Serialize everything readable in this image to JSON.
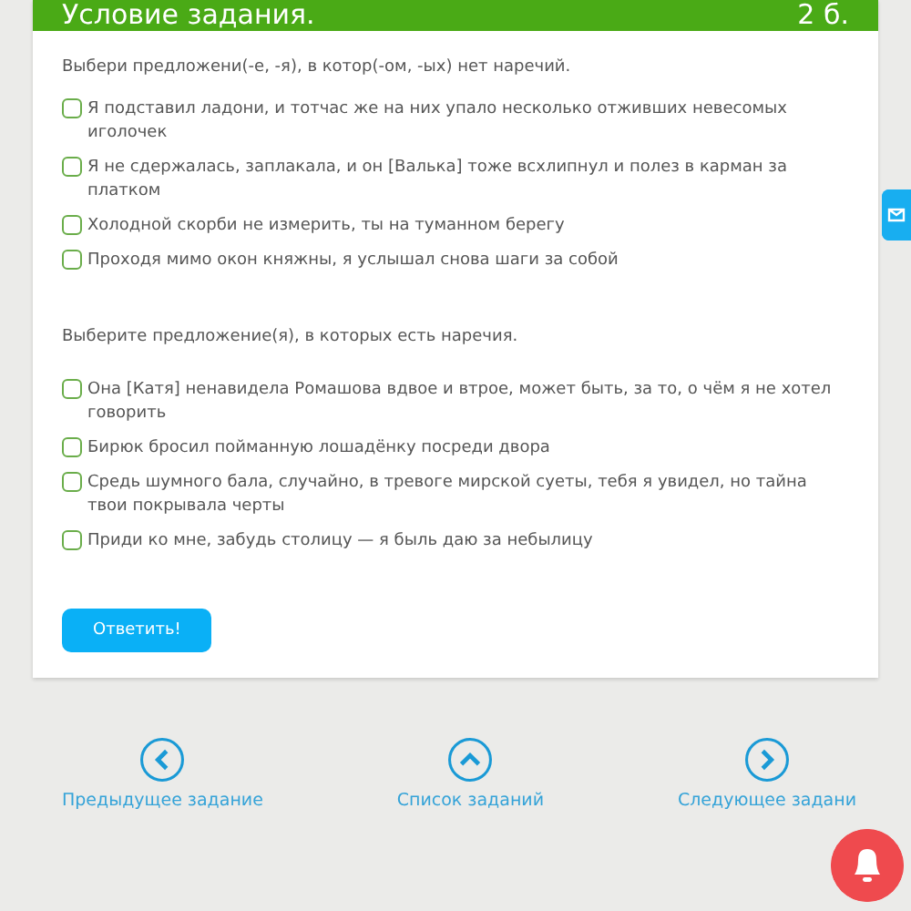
{
  "header": {
    "title": "Условие задания.",
    "points": "2 б."
  },
  "questions": [
    {
      "prompt": "Выбери предложени(-е, -я), в котор(-ом, -ых) нет наречий.",
      "options": [
        {
          "text": "Я подставил ладони, и тотчас же на них упало несколько отживших невесомых иголочек",
          "checked": false
        },
        {
          "text": "Я не сдержалась, заплакала, и он [Валька] тоже всхлипнул и полез в карман за платком",
          "checked": false
        },
        {
          "text": "Холодной скорби не измерить, ты на туманном берегу",
          "checked": false
        },
        {
          "text": "Проходя мимо окон княжны, я услышал снова шаги за собой",
          "checked": false
        }
      ]
    },
    {
      "prompt": "Выберите предложение(я), в которых есть наречия.",
      "options": [
        {
          "text": "Она [Катя] ненавидела Ромашова вдвое и втрое, может быть, за то, о чём я не хотел говорить",
          "checked": false
        },
        {
          "text": "Бирюк бросил пойманную лошадёнку посреди двора",
          "checked": false
        },
        {
          "text": "Средь шумного бала, случайно, в тревоге мирской суеты, тебя я увидел, но тайна твои покрывала черты",
          "checked": false
        },
        {
          "text": "Приди ко мне, забудь столицу — я быль даю за небылицу",
          "checked": false
        }
      ]
    }
  ],
  "submit": "Ответить!",
  "nav": [
    {
      "kind": "prev",
      "label": "Предыдущее задание"
    },
    {
      "kind": "up",
      "label": "Список заданий"
    },
    {
      "kind": "next",
      "label": "Следующее задани"
    }
  ]
}
